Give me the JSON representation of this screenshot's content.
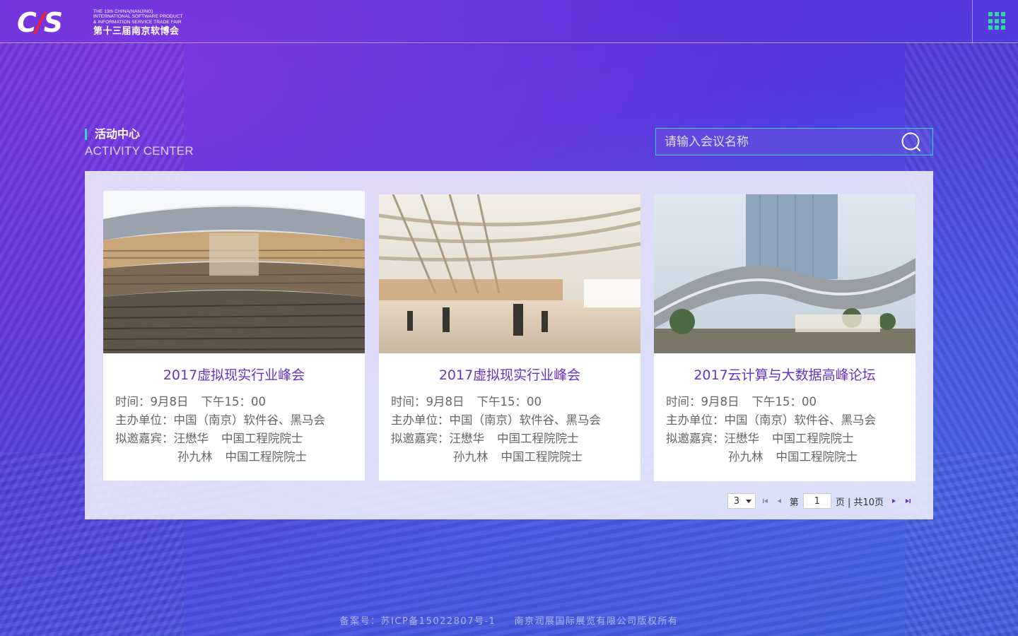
{
  "header": {
    "logo": {
      "mark_part1": "C",
      "mark_slash": "/",
      "mark_part2": "S",
      "line1": "THE 13th CHINA(NANJING)",
      "line2": "INTERNATIONAL SOFTWARE PRODUCT",
      "line3": "& INFORMATION SERVICE TRADE FAIR",
      "cn": "第十三届南京软博会"
    },
    "menu_icon": "grid-menu-icon",
    "accent_color": "#2fd6a6"
  },
  "section": {
    "title_cn": "活动中心",
    "title_en": "ACTIVITY CENTER"
  },
  "search": {
    "placeholder": "请输入会议名称",
    "value": ""
  },
  "cards": [
    {
      "title": "2017虚拟现实行业峰会",
      "time_label": "时间：",
      "time_date": "9月8日",
      "time_clock": "下午15：00",
      "organizer_label": "主办单位：",
      "organizer": "中国（南京）软件谷、黑马会",
      "guests_label": "拟邀嘉宾：",
      "guest1_name": "汪懋华",
      "guest1_title": "中国工程院院士",
      "guest2_name": "孙九林",
      "guest2_title": "中国工程院院士"
    },
    {
      "title": "2017虚拟现实行业峰会",
      "time_label": "时间：",
      "time_date": "9月8日",
      "time_clock": "下午15：00",
      "organizer_label": "主办单位：",
      "organizer": "中国（南京）软件谷、黑马会",
      "guests_label": "拟邀嘉宾：",
      "guest1_name": "汪懋华",
      "guest1_title": "中国工程院院士",
      "guest2_name": "孙九林",
      "guest2_title": "中国工程院院士"
    },
    {
      "title": "2017云计算与大数据高峰论坛",
      "time_label": "时间：",
      "time_date": "9月8日",
      "time_clock": "下午15：00",
      "organizer_label": "主办单位：",
      "organizer": "中国（南京）软件谷、黑马会",
      "guests_label": "拟邀嘉宾：",
      "guest1_name": "汪懋华",
      "guest1_title": "中国工程院院士",
      "guest2_name": "孙九林",
      "guest2_title": "中国工程院院士"
    }
  ],
  "pager": {
    "page_size": "3",
    "page_prefix": "第",
    "current_page": "1",
    "page_suffix": "页 | 共10页",
    "active_color": "#6a30c8"
  },
  "footer": {
    "icp": "备案号：苏ICP备15022807号-1",
    "copyright": "南京润展国际展览有限公司版权所有"
  }
}
